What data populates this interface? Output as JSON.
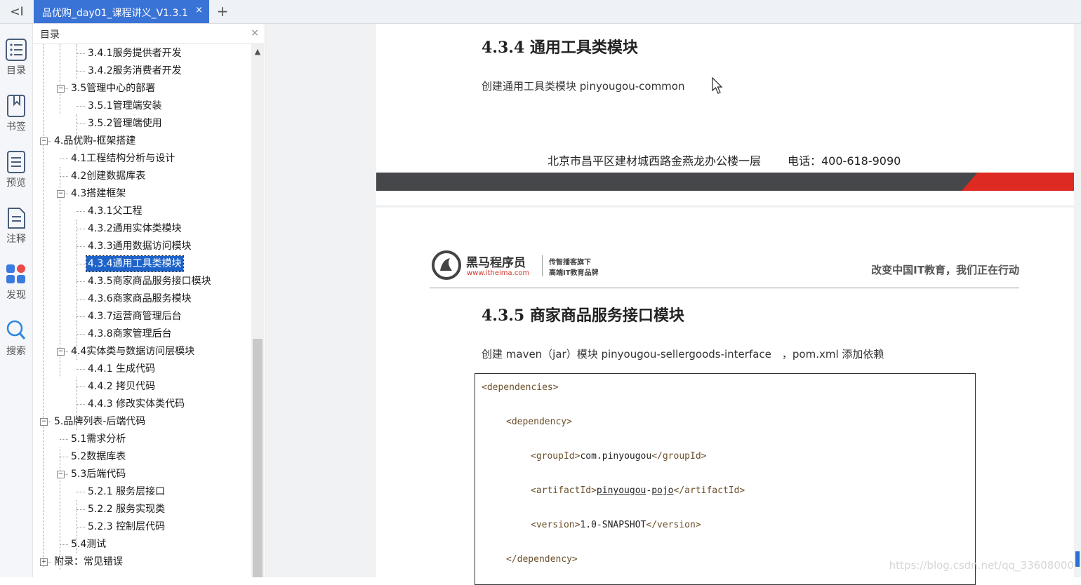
{
  "tabbar": {
    "tab_title": "品优购_day01_课程讲义_V1.3.1",
    "tab_close": "×",
    "add_tab": "+",
    "back": "<I"
  },
  "rail": [
    {
      "label": "目录",
      "icon": "toc-list-icon"
    },
    {
      "label": "书签",
      "icon": "bookmark-icon"
    },
    {
      "label": "预览",
      "icon": "preview-icon"
    },
    {
      "label": "注释",
      "icon": "annotation-icon"
    },
    {
      "label": "发现",
      "icon": "discover-icon"
    },
    {
      "label": "搜索",
      "icon": "search-icon"
    }
  ],
  "toc": {
    "title": "目录",
    "close": "×",
    "items": [
      {
        "text": "3.4.1服务提供者开发",
        "level": 2
      },
      {
        "text": "3.4.2服务消费者开发",
        "level": 2
      },
      {
        "text": "3.5管理中心的部署",
        "level": 1,
        "toggle": "−"
      },
      {
        "text": "3.5.1管理端安装",
        "level": 2
      },
      {
        "text": "3.5.2管理端使用",
        "level": 2
      },
      {
        "text": "4.品优购-框架搭建",
        "level": 0,
        "toggle": "−"
      },
      {
        "text": "4.1工程结构分析与设计",
        "level": 1
      },
      {
        "text": "4.2创建数据库表",
        "level": 1
      },
      {
        "text": "4.3搭建框架",
        "level": 1,
        "toggle": "−"
      },
      {
        "text": "4.3.1父工程",
        "level": 2
      },
      {
        "text": "4.3.2通用实体类模块",
        "level": 2
      },
      {
        "text": "4.3.3通用数据访问模块",
        "level": 2
      },
      {
        "text": "4.3.4通用工具类模块",
        "level": 2,
        "selected": true
      },
      {
        "text": "4.3.5商家商品服务接口模块",
        "level": 2
      },
      {
        "text": "4.3.6商家商品服务模块",
        "level": 2
      },
      {
        "text": "4.3.7运营商管理后台",
        "level": 2
      },
      {
        "text": "4.3.8商家管理后台",
        "level": 2
      },
      {
        "text": "4.4实体类与数据访问层模块",
        "level": 1,
        "toggle": "−"
      },
      {
        "text": "4.4.1 生成代码",
        "level": 2
      },
      {
        "text": "4.4.2 拷贝代码",
        "level": 2
      },
      {
        "text": "4.4.3 修改实体类代码",
        "level": 2
      },
      {
        "text": "5.品牌列表-后端代码",
        "level": 0,
        "toggle": "−"
      },
      {
        "text": "5.1需求分析",
        "level": 1
      },
      {
        "text": "5.2数据库表",
        "level": 1
      },
      {
        "text": "5.3后端代码",
        "level": 1,
        "toggle": "−"
      },
      {
        "text": "5.2.1 服务层接口",
        "level": 2
      },
      {
        "text": "5.2.2 服务实现类",
        "level": 2
      },
      {
        "text": "5.2.3 控制层代码",
        "level": 2
      },
      {
        "text": "5.4测试",
        "level": 1
      },
      {
        "text": "附录：常见错误",
        "level": 0,
        "toggle": "+"
      }
    ]
  },
  "page1": {
    "heading": "4.3.4 通用工具类模块",
    "para": "创建通用工具类模块 pinyougou-common",
    "footer_addr": "北京市昌平区建材城西路金燕龙办公楼一层",
    "footer_tel": "电话：400-618-9090"
  },
  "page2": {
    "brand_name": "黑马程序员",
    "brand_url": "www.itheima.com",
    "brand_sub1": "传智播客旗下",
    "brand_sub2": "高端IT教育品牌",
    "slogan": "改变中国IT教育，我们正在行动",
    "heading": "4.3.5 商家商品服务接口模块",
    "para": "创建 maven（jar）模块 pinyougou-sellergoods-interface　，pom.xml 添加依赖",
    "code": {
      "l1": "<dependencies>",
      "l2": "<dependency>",
      "l3_open": "<groupId>",
      "l3_val": "com.pinyougou",
      "l3_close": "</groupId>",
      "l4_open": "<artifactId>",
      "l4_val_a": "pinyougou",
      "l4_dash": "-",
      "l4_val_b": "pojo",
      "l4_close": "</artifactId>",
      "l5_open": "<version>",
      "l5_val": "1.0-SNAPSHOT",
      "l5_close": "</version>",
      "l6": "</dependency>"
    }
  },
  "watermark": "https://blog.csdn.net/qq_33608000",
  "colors": {
    "accent": "#3a73d6",
    "selection": "#1e63c9",
    "footer_dark": "#45474a",
    "footer_red": "#dd2a22"
  }
}
